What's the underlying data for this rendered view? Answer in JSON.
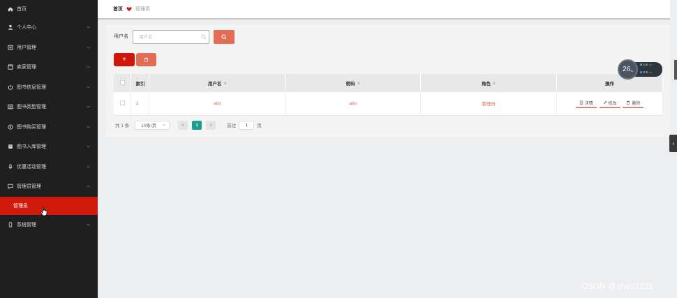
{
  "sidebar": {
    "items": [
      {
        "label": "首页",
        "icon": "home-icon",
        "has_arrow": false
      },
      {
        "label": "个人中心",
        "icon": "user-icon",
        "has_arrow": true
      },
      {
        "label": "用户管理",
        "icon": "grid-icon",
        "has_arrow": true
      },
      {
        "label": "卖家管理",
        "icon": "store-icon",
        "has_arrow": true
      },
      {
        "label": "图书信息管理",
        "icon": "power-icon",
        "has_arrow": true
      },
      {
        "label": "图书类型管理",
        "icon": "grid-icon",
        "has_arrow": true
      },
      {
        "label": "图书购买管理",
        "icon": "compass-icon",
        "has_arrow": true
      },
      {
        "label": "图书入库管理",
        "icon": "box-icon",
        "has_arrow": true
      },
      {
        "label": "优惠活动管理",
        "icon": "mic-icon",
        "has_arrow": true
      },
      {
        "label": "管理员管理",
        "icon": "chat-icon",
        "has_arrow": true,
        "expanded": true
      }
    ],
    "active_sub": "管理员",
    "last_item": {
      "label": "系统管理",
      "icon": "phone-icon"
    }
  },
  "breadcrumb": {
    "home": "首页",
    "current": "管理员"
  },
  "search": {
    "label": "用户名",
    "placeholder": "用户名",
    "value": ""
  },
  "toolbar": {
    "add_label": "+"
  },
  "table": {
    "headers": {
      "index": "索引",
      "username": "用户名",
      "password": "密码",
      "role": "角色",
      "actions": "操作"
    },
    "rows": [
      {
        "index": "1",
        "username": "abo",
        "password": "abo",
        "role": "管理员"
      }
    ],
    "actions": {
      "detail": "详情",
      "edit": "修改",
      "delete": "删除"
    }
  },
  "pagination": {
    "total": "共 1 条",
    "page_size": "10条/页",
    "current_page": "1",
    "goto_label": "前往",
    "goto_value": "1",
    "page_unit": "页"
  },
  "widget": {
    "percent": "26",
    "percent_unit": "%",
    "up": "1.5",
    "up_unit": "K/s",
    "down": "2.3",
    "down_unit": "K/s"
  },
  "watermark": "CSDN @sheji1211",
  "colors": {
    "accent_red": "#d0160c",
    "soft_red": "#e26c54",
    "sidebar_bg": "#1f1f1f",
    "teal": "#1aa08c"
  }
}
